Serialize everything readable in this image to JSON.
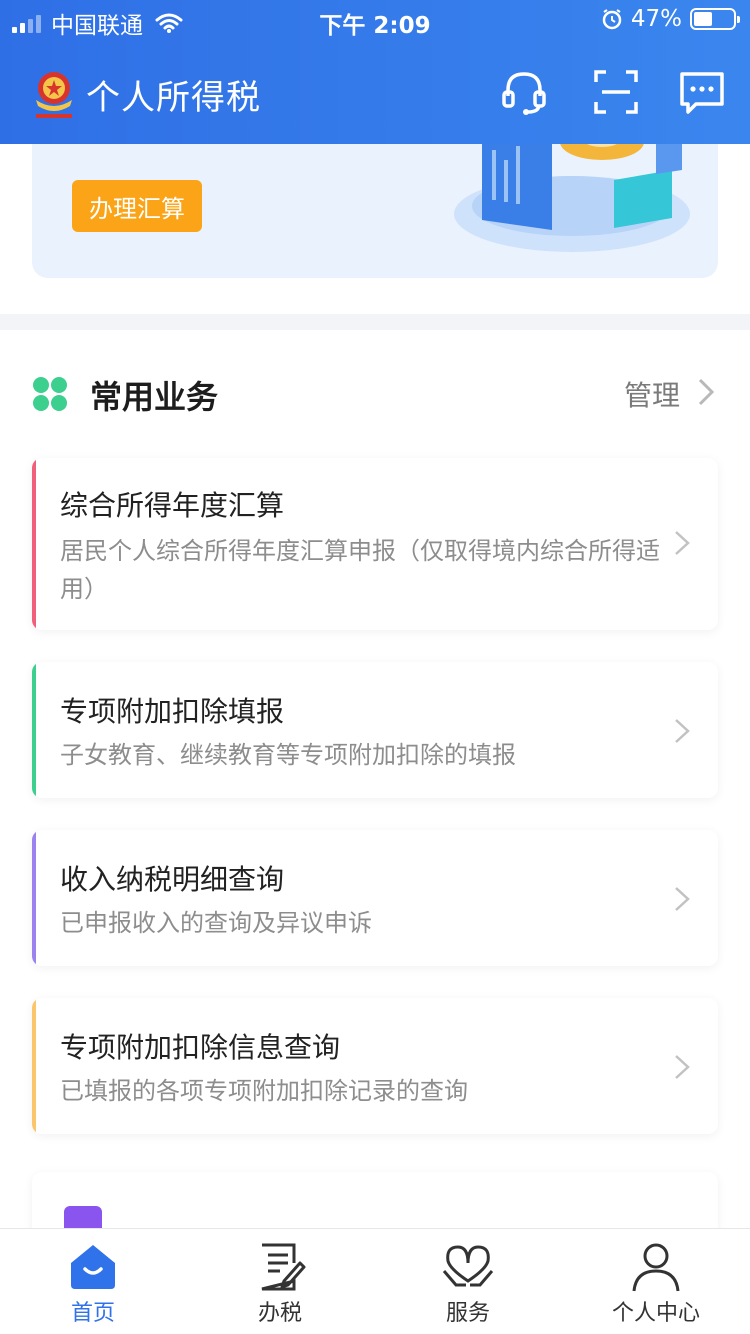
{
  "status_bar": {
    "carrier": "中国联通",
    "time": "下午 2:09",
    "battery_percent": "47%",
    "battery_level": 0.47
  },
  "header": {
    "title": "个人所得税",
    "icons": [
      "headset-icon",
      "scan-icon",
      "message-icon"
    ]
  },
  "banner": {
    "button_label": "办理汇算"
  },
  "section": {
    "title": "常用业务",
    "manage_label": "管理"
  },
  "services": [
    {
      "title": "综合所得年度汇算",
      "desc": "居民个人综合所得年度汇算申报（仅取得境内综合所得适用）",
      "accent": "#f0607a"
    },
    {
      "title": "专项附加扣除填报",
      "desc": "子女教育、继续教育等专项附加扣除的填报",
      "accent": "#3ccf8e"
    },
    {
      "title": "收入纳税明细查询",
      "desc": "已申报收入的查询及异议申诉",
      "accent": "#9b82ef"
    },
    {
      "title": "专项附加扣除信息查询",
      "desc": "已填报的各项专项附加扣除记录的查询",
      "accent": "#fbc56b"
    }
  ],
  "tabs": [
    {
      "label": "首页",
      "icon": "home-icon",
      "active": true
    },
    {
      "label": "办税",
      "icon": "tax-form-icon",
      "active": false
    },
    {
      "label": "服务",
      "icon": "service-icon",
      "active": false
    },
    {
      "label": "个人中心",
      "icon": "user-icon",
      "active": false
    }
  ],
  "colors": {
    "header_blue": "#2f6fe6",
    "active_tab": "#2f72ea",
    "button_orange": "#fba417",
    "section_green": "#3ccf8e"
  }
}
